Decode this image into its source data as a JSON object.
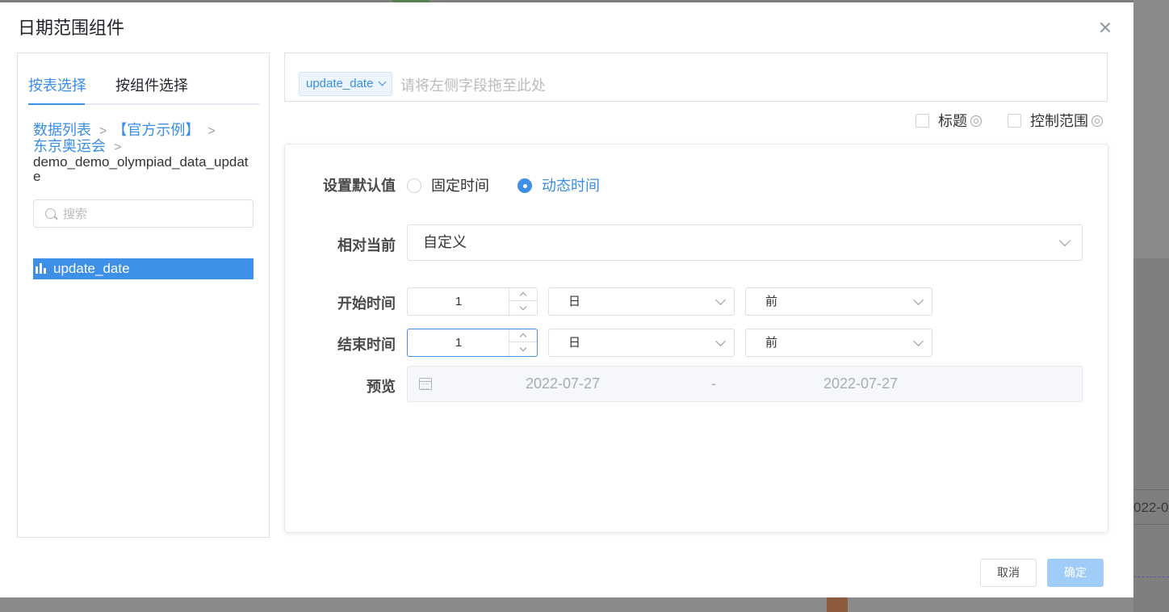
{
  "dialog": {
    "title": "日期范围组件"
  },
  "left": {
    "tabs": [
      {
        "label": "按表选择",
        "active": true
      },
      {
        "label": "按组件选择",
        "active": false
      }
    ],
    "breadcrumb": {
      "items": [
        "数据列表",
        "【官方示例】",
        "东京奥运会"
      ],
      "current": "demo_demo_olympiad_data_update"
    },
    "search": {
      "placeholder": "搜索",
      "value": ""
    },
    "fields": [
      {
        "name": "update_date",
        "icon": "bar-chart-icon",
        "selected": true
      }
    ]
  },
  "dropzone": {
    "tag": "update_date",
    "hint": "请将左侧字段拖至此处"
  },
  "options": {
    "title_label": "标题",
    "title_checked": false,
    "range_label": "控制范围",
    "range_checked": false
  },
  "config": {
    "default_value_label": "设置默认值",
    "mode_options": [
      {
        "label": "固定时间",
        "checked": false
      },
      {
        "label": "动态时间",
        "checked": true
      }
    ],
    "relative_label": "相对当前",
    "relative_value": "自定义",
    "start": {
      "label": "开始时间",
      "amount": "1",
      "unit": "日",
      "direction": "前"
    },
    "end": {
      "label": "结束时间",
      "amount": "1",
      "unit": "日",
      "direction": "前"
    },
    "preview": {
      "label": "预览",
      "start": "2022-07-27",
      "separator": "-",
      "end": "2022-07-27"
    }
  },
  "footer": {
    "cancel": "取消",
    "ok": "确定"
  },
  "background": {
    "partial_date_text": "022-0"
  },
  "colors": {
    "accent": "#3a8ee6",
    "selected_bg": "#3e8fe8",
    "ok_disabled": "#a0cdf7"
  }
}
